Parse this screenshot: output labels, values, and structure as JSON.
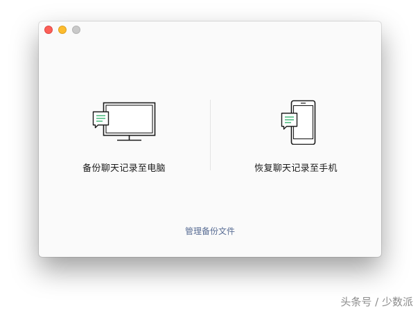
{
  "options": {
    "backup_to_computer": {
      "label": "备份聊天记录至电脑",
      "icon": "computer-chat-icon"
    },
    "restore_to_phone": {
      "label": "恢复聊天记录至手机",
      "icon": "phone-chat-icon"
    }
  },
  "manage_link": "管理备份文件",
  "watermark": "头条号 / 少数派",
  "colors": {
    "accent_green": "#2aae67",
    "link": "#596d94",
    "close": "#fc5f57",
    "minimize": "#fdbc2e",
    "zoom_inactive": "#c9c9c9"
  }
}
